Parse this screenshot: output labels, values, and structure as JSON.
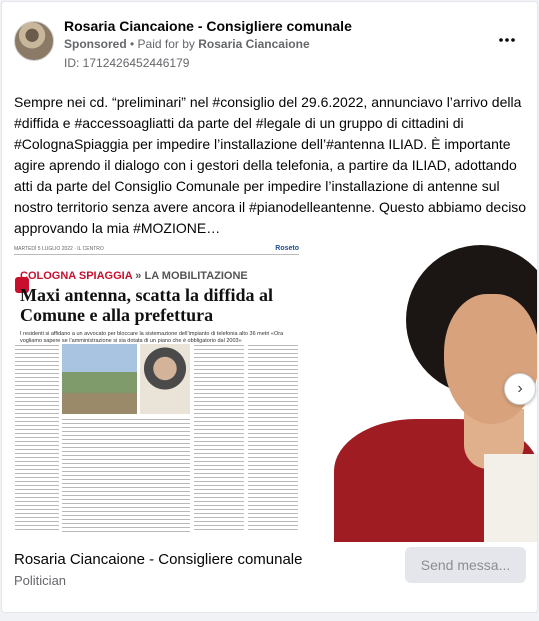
{
  "header": {
    "page_name": "Rosaria Ciancaione - Consigliere comunale",
    "sponsored": "Sponsored",
    "separator": " • ",
    "paid_for_prefix": "Paid for by ",
    "paid_for_name": "Rosaria Ciancaione",
    "ad_id": "ID: 1712426452446179",
    "more_icon": "more-dots-icon"
  },
  "post": {
    "text": "Sempre nei cd. “preliminari” nel #consiglio del 29.6.2022, annunciavo l’arrivo della #diffida e #accessoagliatti da parte del #legale di un gruppo di cittadini di #ColognaSpiaggia per impedire l’installazione dell’#antenna ILIAD. È importante agire aprendo il dialogo con i gestori della telefonia, a partire da ILIAD, adottando atti da parte del Consiglio Comunale per impedire l’installazione di antenne sul nostro territorio senza avere ancora il #pianodelleantenne. Questo abbiamo deciso approvando la mia #MOZIONE…"
  },
  "media": {
    "newspaper": {
      "top_left": "MARTEDÌ 5 LUGLIO 2022 · IL CENTRO",
      "top_right": "Roseto",
      "section_red": "COLOGNA SPIAGGIA",
      "section_gray": " » LA MOBILITAZIONE",
      "headline": "Maxi antenna, scatta la diffida al Comune e alla prefettura",
      "subhead": "I residenti si affidano a un avvocato per bloccare la sistemazione dell’impianto di telefonia alto 36 metri «Ora vogliamo sapere se l’amministrazione si sia dotata di un piano che è obbligatorio dal 2003»"
    },
    "next_icon": "chevron-right-icon",
    "next_glyph": "›"
  },
  "footer": {
    "name": "Rosaria Ciancaione - Consigliere comunale",
    "category": "Politician",
    "send_label": "Send messa..."
  }
}
